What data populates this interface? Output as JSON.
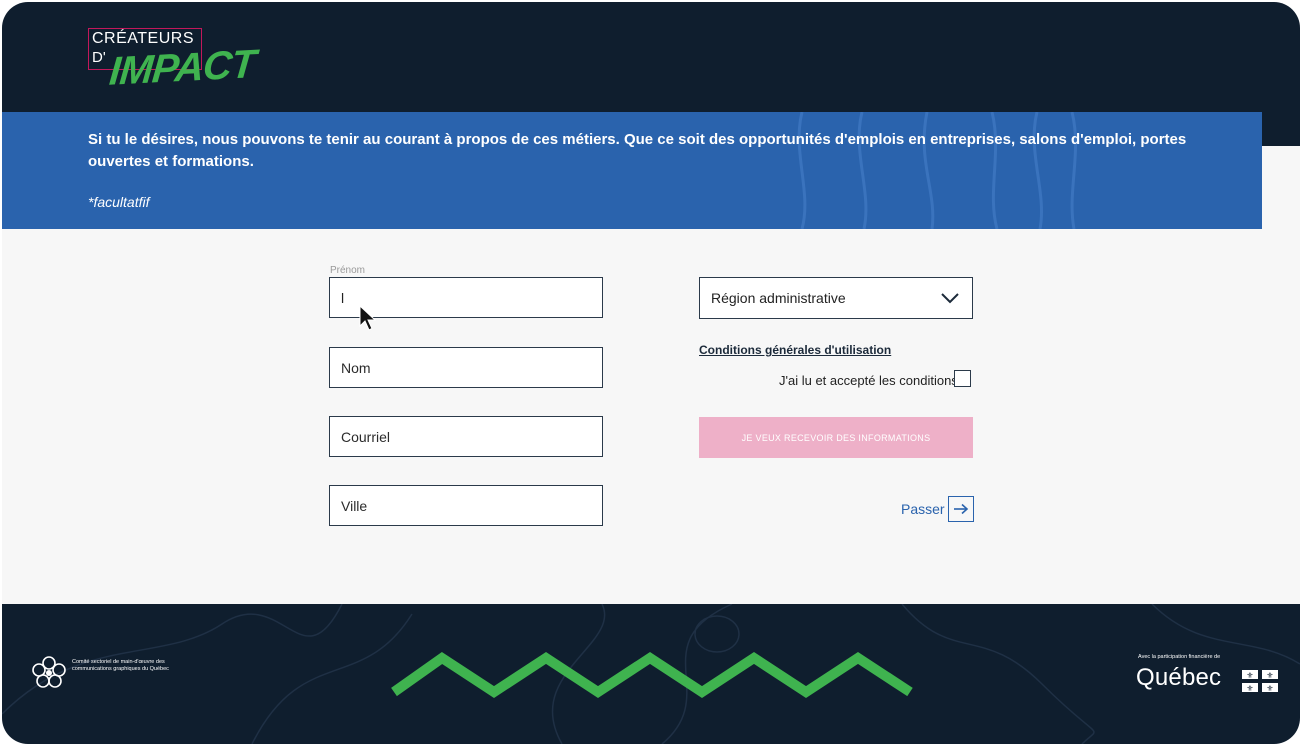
{
  "header": {
    "logo": {
      "line1": "CRÉATEURS",
      "line2": "D'",
      "line3": "IMPACT"
    }
  },
  "banner": {
    "message": "Si tu le désires, nous pouvons te tenir au courant à propos de ces métiers. Que ce soit des opportunités d'emplois en entreprises, salons d'emploi, portes ouvertes et formations.",
    "note": "*facultatfif"
  },
  "form": {
    "prenom": {
      "label": "Prénom",
      "value": "l"
    },
    "nom": {
      "placeholder": "Nom"
    },
    "courriel": {
      "placeholder": "Courriel"
    },
    "ville": {
      "placeholder": "Ville"
    },
    "region": {
      "value": "Région administrative"
    },
    "conditions_link": "Conditions générales d'utilisation",
    "accept_label": "J'ai lu et accepté les conditions",
    "accept_checked": false,
    "submit_label": "JE VEUX RECEVOIR DES INFORMATIONS",
    "skip_label": "Passer"
  },
  "footer": {
    "committee": "Comité sectoriel de main-d'œuvre des communications graphiques du Québec",
    "funder_note": "Avec la participation financière de",
    "funder_name": "Québec"
  },
  "colors": {
    "header_bg": "#0f1e2e",
    "banner_bg": "#2a63ad",
    "brand_green": "#3fb34f",
    "brand_magenta": "#c2185b",
    "submit_disabled": "#eeb0c8",
    "link_blue": "#2a63ad"
  },
  "icons": {
    "select": "chevron-down-icon",
    "skip": "arrow-right-icon",
    "cursor": "mouse-pointer-icon"
  }
}
